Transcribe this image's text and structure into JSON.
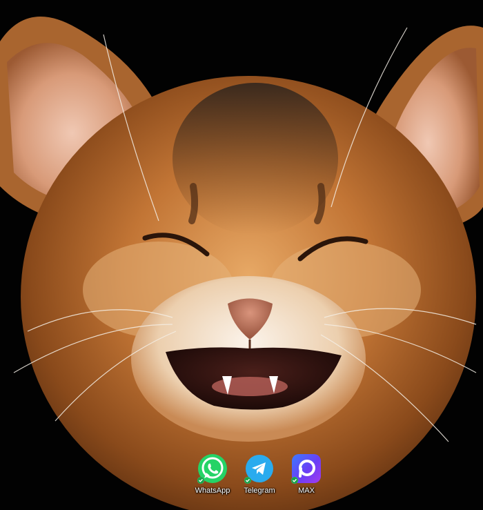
{
  "desktop": {
    "wallpaper": "smiling-kitten-photo",
    "background_color": "#000000",
    "icons": [
      {
        "label": "WhatsApp",
        "icon": "whatsapp-icon",
        "color": "#25D366",
        "status": "synced-check"
      },
      {
        "label": "Telegram",
        "icon": "telegram-icon",
        "color": "#2AABEE",
        "status": "synced-check"
      },
      {
        "label": "MAX",
        "icon": "max-icon",
        "color": "#6A3DF5",
        "status": "synced-check"
      }
    ]
  }
}
